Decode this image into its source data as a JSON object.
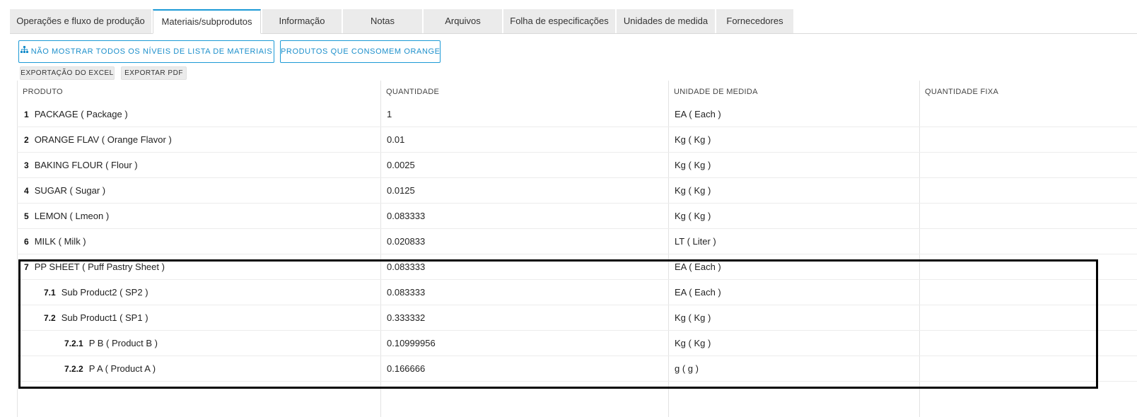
{
  "tabs": [
    {
      "label": "Operações e fluxo de produção"
    },
    {
      "label": "Materiais/subprodutos"
    },
    {
      "label": "Informação"
    },
    {
      "label": "Notas"
    },
    {
      "label": "Arquivos"
    },
    {
      "label": "Folha de especificações"
    },
    {
      "label": "Unidades de medida"
    },
    {
      "label": "Fornecedores"
    }
  ],
  "active_tab": "Materiais/subprodutos",
  "toolbar": {
    "bom_levels_label": "NÃO MOSTRAR TODOS OS NÍVEIS DE LISTA DE MATERIAIS",
    "consumers_label": "PRODUTOS QUE CONSOMEM ORANGE",
    "excel_label": "EXPORTAÇÃO DO EXCEL",
    "pdf_label": "EXPORTAR PDF"
  },
  "table": {
    "headers": {
      "product": "PRODUTO",
      "quantity": "QUANTIDADE",
      "unit": "UNIDADE DE MEDIDA",
      "fixed_quantity": "QUANTIDADE FIXA"
    },
    "rows": [
      {
        "num": "1",
        "product": "PACKAGE ( Package )",
        "quantity": "1",
        "unit": "EA ( Each )",
        "fixed": "",
        "level": 0
      },
      {
        "num": "2",
        "product": "ORANGE FLAV ( Orange Flavor )",
        "quantity": "0.01",
        "unit": "Kg ( Kg )",
        "fixed": "",
        "level": 0
      },
      {
        "num": "3",
        "product": "BAKING FLOUR ( Flour )",
        "quantity": "0.0025",
        "unit": "Kg ( Kg )",
        "fixed": "",
        "level": 0
      },
      {
        "num": "4",
        "product": "SUGAR ( Sugar )",
        "quantity": "0.0125",
        "unit": "Kg ( Kg )",
        "fixed": "",
        "level": 0
      },
      {
        "num": "5",
        "product": "LEMON ( Lmeon )",
        "quantity": "0.083333",
        "unit": "Kg ( Kg )",
        "fixed": "",
        "level": 0
      },
      {
        "num": "6",
        "product": "MILK ( Milk )",
        "quantity": "0.020833",
        "unit": "LT ( Liter )",
        "fixed": "",
        "level": 0
      },
      {
        "num": "7",
        "product": "PP SHEET ( Puff Pastry Sheet )",
        "quantity": "0.083333",
        "unit": "EA ( Each )",
        "fixed": "",
        "level": 0
      },
      {
        "num": "7.1",
        "product": "Sub Product2 ( SP2 )",
        "quantity": "0.083333",
        "unit": "EA ( Each )",
        "fixed": "",
        "level": 1
      },
      {
        "num": "7.2",
        "product": "Sub Product1 ( SP1 )",
        "quantity": "0.333332",
        "unit": "Kg ( Kg )",
        "fixed": "",
        "level": 1
      },
      {
        "num": "7.2.1",
        "product": "P B ( Product B )",
        "quantity": "0.10999956",
        "unit": "Kg ( Kg )",
        "fixed": "",
        "level": 2
      },
      {
        "num": "7.2.2",
        "product": "P A ( Product A )",
        "quantity": "0.166666",
        "unit": "g ( g )",
        "fixed": "",
        "level": 2
      }
    ]
  },
  "colors": {
    "accent": "#1c9ad6",
    "tab_bg": "#ebebeb",
    "highlight_border": "#000000"
  },
  "icons": {
    "bom_levels": "hierarchy-icon"
  }
}
